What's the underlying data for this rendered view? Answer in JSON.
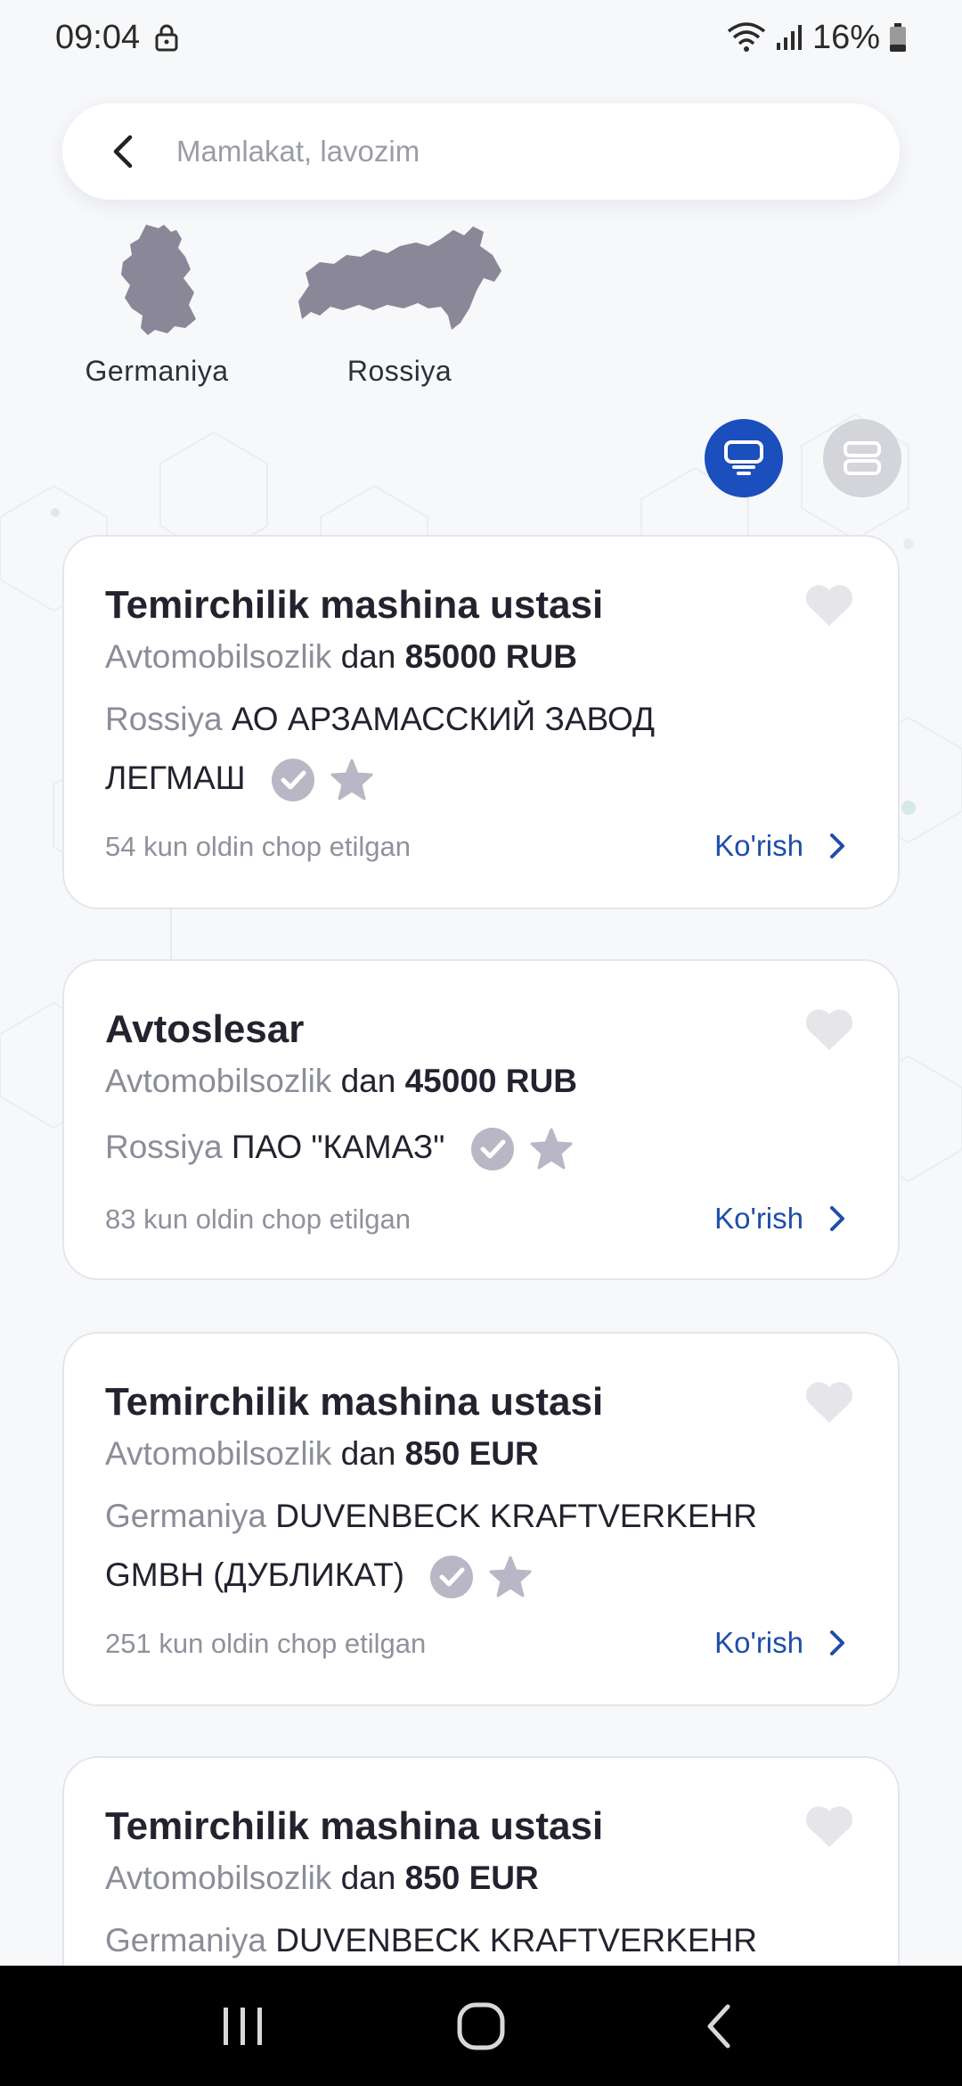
{
  "status_bar": {
    "time": "09:04",
    "battery": "16%"
  },
  "search": {
    "placeholder": "Mamlakat, lavozim"
  },
  "countries": [
    {
      "label": "Germaniya"
    },
    {
      "label": "Rossiya"
    }
  ],
  "colors": {
    "accent": "#1a4fbd",
    "link": "#1f4ea8",
    "muted": "#8b8d98",
    "icon_gray": "#b9b6c6"
  },
  "jobs": [
    {
      "title": "Temirchilik mashina ustasi",
      "industry": "Avtomobilsozlik",
      "from_word": "dan",
      "salary": "85000 RUB",
      "country": "Rossiya",
      "company_line1": "АО АРЗАМАССКИЙ ЗАВОД",
      "company_line2": "ЛЕГМАШ",
      "posted": "54 kun oldin chop etilgan",
      "view_label": "Ko'rish"
    },
    {
      "title": "Avtoslesar",
      "industry": "Avtomobilsozlik",
      "from_word": "dan",
      "salary": "45000 RUB",
      "country": "Rossiya",
      "company_line1": "ПАО \"КАМАЗ\"",
      "posted": "83 kun oldin chop etilgan",
      "view_label": "Ko'rish"
    },
    {
      "title": "Temirchilik mashina ustasi",
      "industry": "Avtomobilsozlik",
      "from_word": "dan",
      "salary": "850 EUR",
      "country": "Germaniya",
      "company_line1": "DUVENBECK KRAFTVERKEHR",
      "company_line2": "GMBH (ДУБЛИКАТ)",
      "posted": "251 kun oldin chop etilgan",
      "view_label": "Ko'rish"
    },
    {
      "title": "Temirchilik mashina ustasi",
      "industry": "Avtomobilsozlik",
      "from_word": "dan",
      "salary": "850 EUR",
      "country": "Germaniya",
      "company_line1": "DUVENBECK KRAFTVERKEHR"
    }
  ]
}
